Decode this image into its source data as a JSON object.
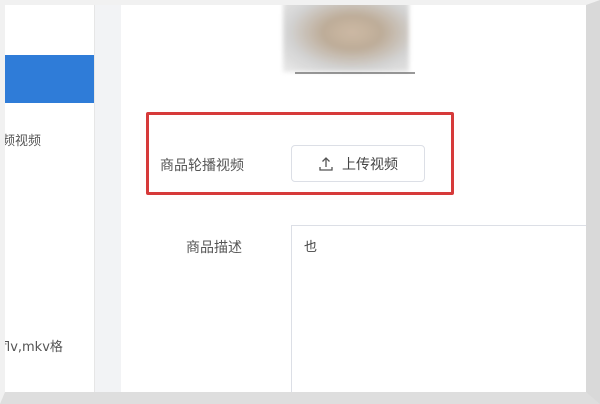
{
  "sidebar": {
    "partial_text_1": "频视频",
    "partial_text_2": "flv,mkv格"
  },
  "form": {
    "carousel_video_label": "商品轮播视频",
    "upload_button_label": "上传视频",
    "description_label": "商品描述",
    "description_value": "也"
  },
  "colors": {
    "highlight": "#d63a3a",
    "sidebar_active": "#2f7cd8"
  },
  "icons": {
    "upload": "upload-icon"
  }
}
